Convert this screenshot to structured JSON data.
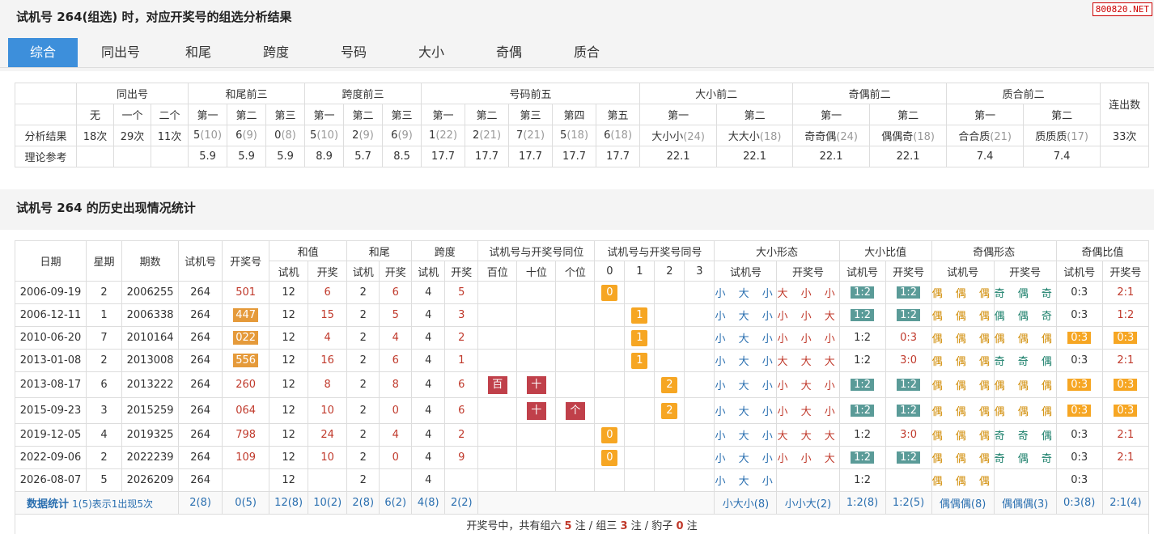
{
  "header": {
    "title": "试机号 264(组选) 时，对应开奖号的组选分析结果",
    "site": "800820.NET"
  },
  "tabs": [
    "综合",
    "同出号",
    "和尾",
    "跨度",
    "号码",
    "大小",
    "奇偶",
    "质合"
  ],
  "summary": {
    "groups": [
      "同出号",
      "和尾前三",
      "跨度前三",
      "号码前五",
      "大小前二",
      "奇偶前二",
      "质合前二",
      "连出数"
    ],
    "sub": {
      "tongchu": [
        "无",
        "一个",
        "二个"
      ],
      "hewei": [
        "第一",
        "第二",
        "第三"
      ],
      "kuadu": [
        "第一",
        "第二",
        "第三"
      ],
      "haoma": [
        "第一",
        "第二",
        "第三",
        "第四",
        "第五"
      ],
      "daxiao": [
        "第一",
        "第二"
      ],
      "jiou": [
        "第一",
        "第二"
      ],
      "zhihe": [
        "第一",
        "第二"
      ]
    },
    "result_label": "分析结果",
    "reference_label": "理论参考",
    "result": {
      "tongchu": [
        "18次",
        "29次",
        "11次"
      ],
      "hewei": [
        [
          "5",
          "(10)"
        ],
        [
          "6",
          "(9)"
        ],
        [
          "0",
          "(8)"
        ]
      ],
      "kuadu": [
        [
          "5",
          "(10)"
        ],
        [
          "2",
          "(9)"
        ],
        [
          "6",
          "(9)"
        ]
      ],
      "haoma": [
        [
          "1",
          "(22)"
        ],
        [
          "2",
          "(21)"
        ],
        [
          "7",
          "(21)"
        ],
        [
          "5",
          "(18)"
        ],
        [
          "6",
          "(18)"
        ]
      ],
      "daxiao": [
        [
          "大小小",
          "(24)"
        ],
        [
          "大大小",
          "(18)"
        ]
      ],
      "jiou": [
        [
          "奇奇偶",
          "(24)"
        ],
        [
          "偶偶奇",
          "(18)"
        ]
      ],
      "zhihe": [
        [
          "合合质",
          "(21)"
        ],
        [
          "质质质",
          "(17)"
        ]
      ],
      "lianchu": "33次"
    },
    "reference": {
      "hewei": [
        "5.9",
        "5.9",
        "5.9"
      ],
      "kuadu": [
        "8.9",
        "5.7",
        "8.5"
      ],
      "haoma": [
        "17.7",
        "17.7",
        "17.7",
        "17.7",
        "17.7"
      ],
      "daxiao": [
        "22.1",
        "22.1"
      ],
      "jiou": [
        "22.1",
        "22.1"
      ],
      "zhihe": [
        "7.4",
        "7.4"
      ]
    }
  },
  "history_title": "试机号 264 的历史出现情况统计",
  "history": {
    "head": {
      "date": "日期",
      "week": "星期",
      "issue": "期数",
      "trial": "试机号",
      "draw": "开奖号",
      "sum": "和值",
      "tail": "和尾",
      "span": "跨度",
      "samepos": "试机号与开奖号同位",
      "same": "试机号与开奖号同号",
      "bs_form": "大小形态",
      "bs_ratio": "大小比值",
      "oe_form": "奇偶形态",
      "oe_ratio": "奇偶比值",
      "sub_trial": "试机",
      "sub_draw": "开奖",
      "sub_trialno": "试机号",
      "sub_drawno": "开奖号",
      "pos": [
        "百位",
        "十位",
        "个位"
      ],
      "nums": [
        "0",
        "1",
        "2",
        "3"
      ]
    },
    "rows": [
      {
        "date": "2006-09-19",
        "week": "2",
        "issue": "2006255",
        "trial": "264",
        "draw": "501",
        "draw_box": false,
        "sum_t": "12",
        "sum_d": "6",
        "tail_t": "2",
        "tail_d": "6",
        "span_t": "4",
        "span_d": "5",
        "pos": [
          "",
          "",
          ""
        ],
        "same": [
          "0",
          "",
          "",
          ""
        ],
        "bs_t": "小大小",
        "bs_d": "大小小",
        "bsr_t": "1:2",
        "bsr_t_box": true,
        "bsr_d": "1:2",
        "bsr_d_box": true,
        "oe_t": "偶偶偶",
        "oe_d": "奇偶奇",
        "oe_d_teal": true,
        "oer_t": "0:3",
        "oer_t_box": false,
        "oer_d": "2:1",
        "oer_d_box": false
      },
      {
        "date": "2006-12-11",
        "week": "1",
        "issue": "2006338",
        "trial": "264",
        "draw": "447",
        "draw_box": true,
        "sum_t": "12",
        "sum_d": "15",
        "tail_t": "2",
        "tail_d": "5",
        "span_t": "4",
        "span_d": "3",
        "pos": [
          "",
          "",
          ""
        ],
        "same": [
          "",
          "1",
          "",
          ""
        ],
        "bs_t": "小大小",
        "bs_d": "小小大",
        "bsr_t": "1:2",
        "bsr_t_box": true,
        "bsr_d": "1:2",
        "bsr_d_box": true,
        "oe_t": "偶偶偶",
        "oe_d": "偶偶奇",
        "oe_d_teal": true,
        "oer_t": "0:3",
        "oer_t_box": false,
        "oer_d": "1:2",
        "oer_d_box": false
      },
      {
        "date": "2010-06-20",
        "week": "7",
        "issue": "2010164",
        "trial": "264",
        "draw": "022",
        "draw_box": true,
        "sum_t": "12",
        "sum_d": "4",
        "tail_t": "2",
        "tail_d": "4",
        "span_t": "4",
        "span_d": "2",
        "pos": [
          "",
          "",
          ""
        ],
        "same": [
          "",
          "1",
          "",
          ""
        ],
        "bs_t": "小大小",
        "bs_d": "小小小",
        "bsr_t": "1:2",
        "bsr_t_box": false,
        "bsr_d": "0:3",
        "bsr_d_box": false,
        "oe_t": "偶偶偶",
        "oe_d": "偶偶偶",
        "oe_d_teal": false,
        "oer_t": "0:3",
        "oer_t_box": true,
        "oer_d": "0:3",
        "oer_d_box": true
      },
      {
        "date": "2013-01-08",
        "week": "2",
        "issue": "2013008",
        "trial": "264",
        "draw": "556",
        "draw_box": true,
        "sum_t": "12",
        "sum_d": "16",
        "tail_t": "2",
        "tail_d": "6",
        "span_t": "4",
        "span_d": "1",
        "pos": [
          "",
          "",
          ""
        ],
        "same": [
          "",
          "1",
          "",
          ""
        ],
        "bs_t": "小大小",
        "bs_d": "大大大",
        "bsr_t": "1:2",
        "bsr_t_box": false,
        "bsr_d": "3:0",
        "bsr_d_box": false,
        "oe_t": "偶偶偶",
        "oe_d": "奇奇偶",
        "oe_d_teal": true,
        "oer_t": "0:3",
        "oer_t_box": false,
        "oer_d": "2:1",
        "oer_d_box": false
      },
      {
        "date": "2013-08-17",
        "week": "6",
        "issue": "2013222",
        "trial": "264",
        "draw": "260",
        "draw_box": false,
        "sum_t": "12",
        "sum_d": "8",
        "tail_t": "2",
        "tail_d": "8",
        "span_t": "4",
        "span_d": "6",
        "pos": [
          "百",
          "十",
          ""
        ],
        "same": [
          "",
          "",
          "2",
          ""
        ],
        "bs_t": "小大小",
        "bs_d": "小大小",
        "bsr_t": "1:2",
        "bsr_t_box": true,
        "bsr_d": "1:2",
        "bsr_d_box": true,
        "oe_t": "偶偶偶",
        "oe_d": "偶偶偶",
        "oe_d_teal": false,
        "oer_t": "0:3",
        "oer_t_box": true,
        "oer_d": "0:3",
        "oer_d_box": true
      },
      {
        "date": "2015-09-23",
        "week": "3",
        "issue": "2015259",
        "trial": "264",
        "draw": "064",
        "draw_box": false,
        "sum_t": "12",
        "sum_d": "10",
        "tail_t": "2",
        "tail_d": "0",
        "span_t": "4",
        "span_d": "6",
        "pos": [
          "",
          "十",
          "个"
        ],
        "same": [
          "",
          "",
          "2",
          ""
        ],
        "bs_t": "小大小",
        "bs_d": "小大小",
        "bsr_t": "1:2",
        "bsr_t_box": true,
        "bsr_d": "1:2",
        "bsr_d_box": true,
        "oe_t": "偶偶偶",
        "oe_d": "偶偶偶",
        "oe_d_teal": false,
        "oer_t": "0:3",
        "oer_t_box": true,
        "oer_d": "0:3",
        "oer_d_box": true
      },
      {
        "date": "2019-12-05",
        "week": "4",
        "issue": "2019325",
        "trial": "264",
        "draw": "798",
        "draw_box": false,
        "sum_t": "12",
        "sum_d": "24",
        "tail_t": "2",
        "tail_d": "4",
        "span_t": "4",
        "span_d": "2",
        "pos": [
          "",
          "",
          ""
        ],
        "same": [
          "0",
          "",
          "",
          ""
        ],
        "bs_t": "小大小",
        "bs_d": "大大大",
        "bsr_t": "1:2",
        "bsr_t_box": false,
        "bsr_d": "3:0",
        "bsr_d_box": false,
        "oe_t": "偶偶偶",
        "oe_d": "奇奇偶",
        "oe_d_teal": true,
        "oer_t": "0:3",
        "oer_t_box": false,
        "oer_d": "2:1",
        "oer_d_box": false
      },
      {
        "date": "2022-09-06",
        "week": "2",
        "issue": "2022239",
        "trial": "264",
        "draw": "109",
        "draw_box": false,
        "sum_t": "12",
        "sum_d": "10",
        "tail_t": "2",
        "tail_d": "0",
        "span_t": "4",
        "span_d": "9",
        "pos": [
          "",
          "",
          ""
        ],
        "same": [
          "0",
          "",
          "",
          ""
        ],
        "bs_t": "小大小",
        "bs_d": "小小大",
        "bsr_t": "1:2",
        "bsr_t_box": true,
        "bsr_d": "1:2",
        "bsr_d_box": true,
        "oe_t": "偶偶偶",
        "oe_d": "奇偶奇",
        "oe_d_teal": true,
        "oer_t": "0:3",
        "oer_t_box": false,
        "oer_d": "2:1",
        "oer_d_box": false
      },
      {
        "date": "2026-08-07",
        "week": "5",
        "issue": "2026209",
        "trial": "264",
        "draw": "",
        "draw_box": false,
        "sum_t": "12",
        "sum_d": "",
        "tail_t": "2",
        "tail_d": "",
        "span_t": "4",
        "span_d": "",
        "pos": [
          "",
          "",
          ""
        ],
        "same": [
          "",
          "",
          "",
          ""
        ],
        "bs_t": "小大小",
        "bs_d": "",
        "bsr_t": "1:2",
        "bsr_t_box": false,
        "bsr_d": "",
        "bsr_d_box": false,
        "oe_t": "偶偶偶",
        "oe_d": "",
        "oe_d_teal": false,
        "oer_t": "0:3",
        "oer_t_box": false,
        "oer_d": "",
        "oer_d_box": false
      }
    ],
    "stats": {
      "label": "数据统计",
      "note": "1(5)表示1出现5次",
      "trial": "2(8)",
      "draw": "0(5)",
      "sum_t": "12(8)",
      "sum_d": "10(2)",
      "tail_t": "2(8)",
      "tail_d": "6(2)",
      "span_t": "4(8)",
      "span_d": "2(2)",
      "bs_t": "小大小(8)",
      "bs_d": "小小大(2)",
      "bsr_t": "1:2(8)",
      "bsr_d": "1:2(5)",
      "oe_t": "偶偶偶(8)",
      "oe_d": "偶偶偶(3)",
      "oer_t": "0:3(8)",
      "oer_d": "2:1(4)"
    },
    "footer": {
      "p1": "开奖号中，共有组六 ",
      "n1": "5",
      "p2": " 注 / 组三 ",
      "n2": "3",
      "p3": " 注 / 豹子 ",
      "n3": "0",
      "p4": " 注"
    }
  }
}
